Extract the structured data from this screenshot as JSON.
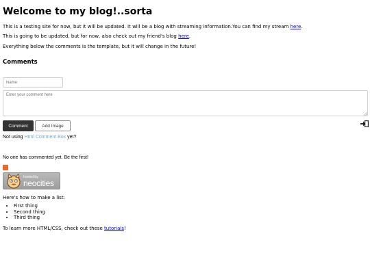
{
  "header": {
    "title": "Welcome to my blog!..sorta"
  },
  "intro": {
    "line1_text": "This is a testing site for now, but it will be updated. It will be a blog with streaming information.You can find my stream ",
    "line1_link": "here",
    "line1_end": ".",
    "line2_text": "This is going to be updated, but for now, also check out my friend's blog ",
    "line2_link": "here",
    "line2_end": ".",
    "line3_text": "Everything below the comments is the template, but it will change in the future!"
  },
  "comments": {
    "heading": "Comments",
    "name_placeholder": "Name",
    "comment_placeholder": "Enter your comment here",
    "comment_button": "Comment",
    "add_image_button": "Add Image",
    "not_using_prefix": "Not using ",
    "not_using_link": "Html Comment Box",
    "not_using_suffix": "  yet?",
    "no_comments": "No one has commented yet. Be the first!"
  },
  "badge": {
    "hosted_by": "hosted by",
    "name": "neocities"
  },
  "template": {
    "list_intro": "Here's how to make a list:",
    "list_items": [
      "First thing",
      "Second thing",
      "Third thing"
    ],
    "learn_text": "To learn more HTML/CSS, check out these ",
    "learn_link": "tutorials",
    "learn_end": "!"
  },
  "colors": {
    "link": "#0000ee",
    "button_dark": "#333333",
    "rss": "#f26522",
    "hcb_link": "#6fb0da"
  }
}
